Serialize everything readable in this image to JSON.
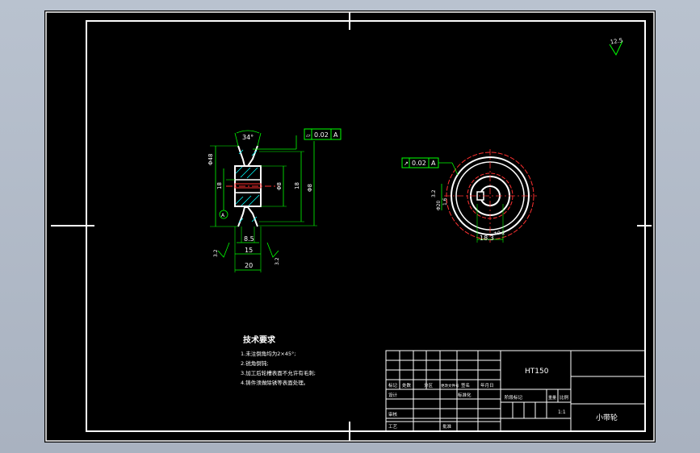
{
  "drawing": {
    "roughness_note": "12.5",
    "dims": {
      "groove_angle": "34°",
      "flatness_box": {
        "symbol": "⏥",
        "value": "0.02",
        "datum": "A"
      },
      "runout_box": {
        "symbol": "↗",
        "value": "0.02",
        "datum": "A"
      },
      "dia_left_1": "Φ48",
      "dia_left_2": "18",
      "dia_right_1": "Φ8",
      "dia_right_2": "Φ8",
      "width_hub": "8.5",
      "width_15": "15",
      "width_20": "20",
      "rough_left": "3.2",
      "rough_right": "3.2",
      "rough_side": "3.2",
      "key_dim": "18.3",
      "key_tol": "+0.2",
      "datum_label": "A",
      "bore_dim": "Φ20",
      "side_small": "1.6"
    },
    "tech": {
      "title": "技术要求",
      "lines": [
        "1.未注倒角均为2×45°;",
        "2.锐角倒钝;",
        "3.加工后轮槽表面不允许有毛刺;",
        "4.铸件须做除锈等表面处理。"
      ]
    },
    "title_block": {
      "material": "HT150",
      "part_name": "小带轮",
      "ratio": "1:1",
      "cells": {
        "mark": "标记",
        "count": "处数",
        "zone": "分区",
        "change_no": "更改文件号",
        "sign": "签名",
        "date": "年月日",
        "design": "设计",
        "standardize": "标准化",
        "check": "审核",
        "craft": "工艺",
        "approve": "批准",
        "stage_mark": "阶段标记",
        "weight": "重量",
        "scale": "比例"
      }
    }
  }
}
